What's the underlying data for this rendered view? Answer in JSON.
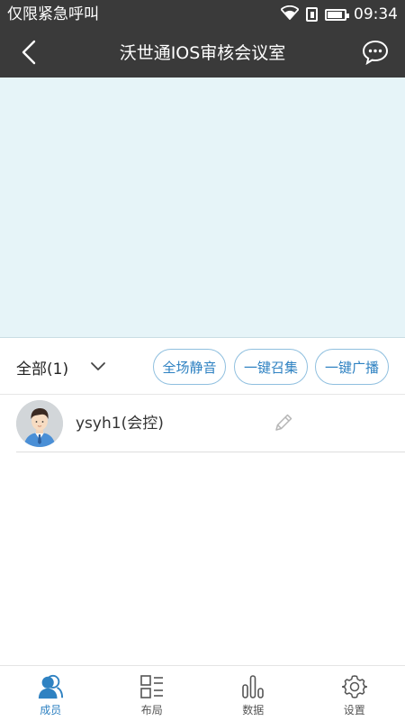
{
  "status_bar": {
    "carrier": "仅限紧急呼叫",
    "time": "09:34"
  },
  "header": {
    "title": "沃世通IOS审核会议室",
    "back_icon": "chevron-left-icon",
    "chat_icon": "chat-bubble-icon"
  },
  "controls": {
    "filter_label": "全部(1)",
    "buttons": {
      "mute_all": "全场静音",
      "call_all": "一键召集",
      "broadcast": "一键广播"
    }
  },
  "members": [
    {
      "name": "ysyh1(会控)",
      "avatar_icon": "user-avatar",
      "edit_icon": "pencil-icon"
    }
  ],
  "tabs": [
    {
      "label": "成员",
      "icon": "members-icon",
      "active": true
    },
    {
      "label": "布局",
      "icon": "layout-icon",
      "active": false
    },
    {
      "label": "数据",
      "icon": "data-chart-icon",
      "active": false
    },
    {
      "label": "设置",
      "icon": "gear-icon",
      "active": false
    }
  ],
  "colors": {
    "bar_background": "#3a3a3a",
    "video_background": "#e6f4f8",
    "accent": "#2f82c2"
  }
}
